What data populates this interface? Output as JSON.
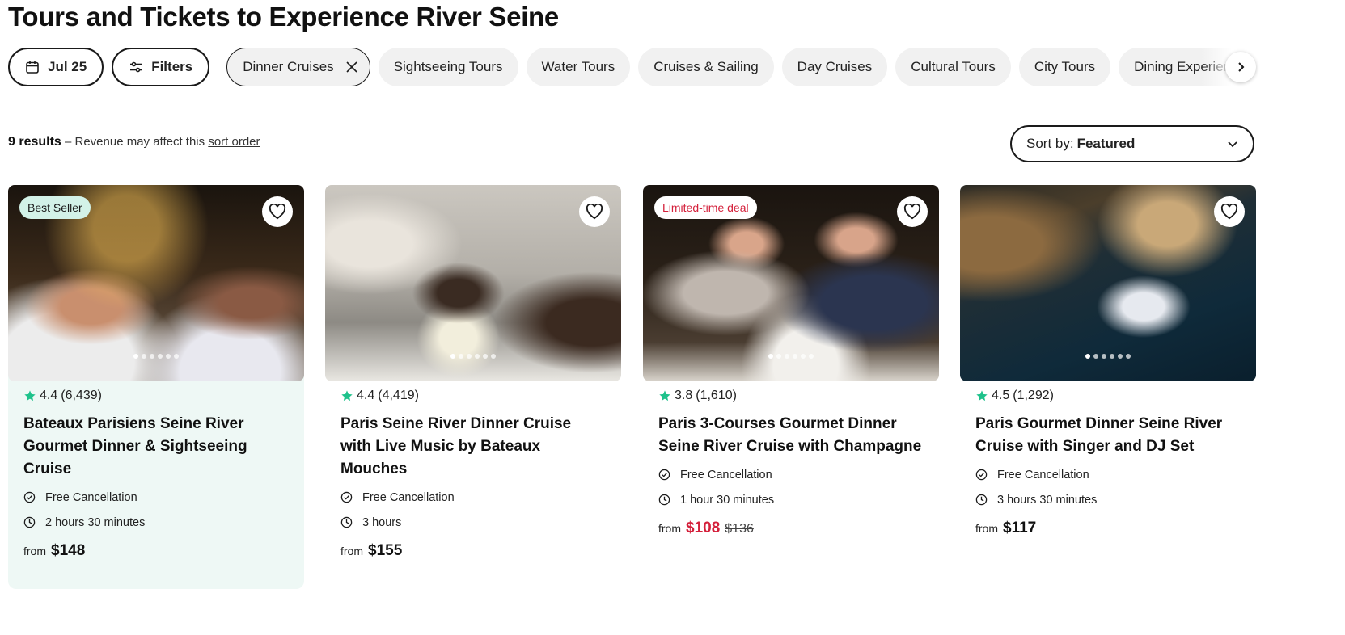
{
  "page": {
    "title": "Tours and Tickets to Experience River Seine"
  },
  "filters": {
    "date_label": "Jul 25",
    "filters_label": "Filters",
    "active_chip": "Dinner Cruises",
    "chips": [
      "Sightseeing Tours",
      "Water Tours",
      "Cruises & Sailing",
      "Day Cruises",
      "Cultural Tours",
      "City Tours",
      "Dining Experiences"
    ]
  },
  "results": {
    "count": "9 results",
    "note": "– Revenue may affect this",
    "sort_link": "sort order"
  },
  "sort": {
    "prefix": "Sort by:",
    "value": "Featured"
  },
  "colors": {
    "star": "#1ec28b",
    "sale": "#d4203b",
    "best_seller_bg": "#d3f2e8",
    "highlight_bg": "#eef8f5"
  },
  "cards": [
    {
      "badge": "Best Seller",
      "rating": "4.4",
      "reviews": "(6,439)",
      "title": "Bateaux Parisiens Seine River Gourmet Dinner & Sightseeing Cruise",
      "cancellation": "Free Cancellation",
      "duration": "2 hours 30 minutes",
      "from": "from",
      "price": "$148"
    },
    {
      "rating": "4.4",
      "reviews": "(4,419)",
      "title": "Paris Seine River Dinner Cruise with Live Music by Bateaux Mouches",
      "cancellation": "Free Cancellation",
      "duration": "3 hours",
      "from": "from",
      "price": "$155"
    },
    {
      "badge": "Limited-time deal",
      "rating": "3.8",
      "reviews": "(1,610)",
      "title": "Paris 3-Courses Gourmet Dinner Seine River Cruise with Champagne",
      "cancellation": "Free Cancellation",
      "duration": "1 hour 30 minutes",
      "from": "from",
      "price": "$108",
      "original_price": "$136"
    },
    {
      "rating": "4.5",
      "reviews": "(1,292)",
      "title": "Paris Gourmet Dinner Seine River Cruise with Singer and DJ Set",
      "cancellation": "Free Cancellation",
      "duration": "3 hours 30 minutes",
      "from": "from",
      "price": "$117"
    }
  ]
}
